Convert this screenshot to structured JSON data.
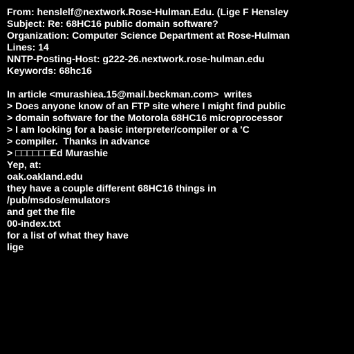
{
  "colors": {
    "background": "#000000",
    "text": "#ffffff"
  },
  "header": {
    "from": "From: henslelf@nextwork.Rose-Hulman.Edu. (Lige F Hensley",
    "subject": "Subject: Re: 68HC16 public domain software?",
    "organization": "Organization: Computer Science Department at Rose-Hulman",
    "lines": "Lines: 14",
    "nntp_posting_host": "NNTP-Posting-Host: g222-26.nextwork.rose-hulman.edu",
    "keywords": "Keywords: 68hc16"
  },
  "body": {
    "attribution": "In article <murashiea.15@mail.beckman.com>  writes",
    "quote_1": "> Does anyone know of an FTP site where I might find public",
    "quote_2": "> domain software for the Motorola 68HC16 microprocessor",
    "quote_3": "> I am looking for a basic interpreter/compiler or a 'C",
    "quote_4": "> compiler.  Thanks in advance",
    "quote_5": "> □□□□□□Ed Murashie",
    "reply_1": "Yep, at:",
    "reply_2": "oak.oakland.edu",
    "reply_3": "they have a couple different 68HC16 things in",
    "reply_4": "/pub/msdos/emulators",
    "reply_5": "and get the file",
    "reply_6": "00-index.txt",
    "reply_7": "for a list of what they have",
    "signature": "lige"
  }
}
